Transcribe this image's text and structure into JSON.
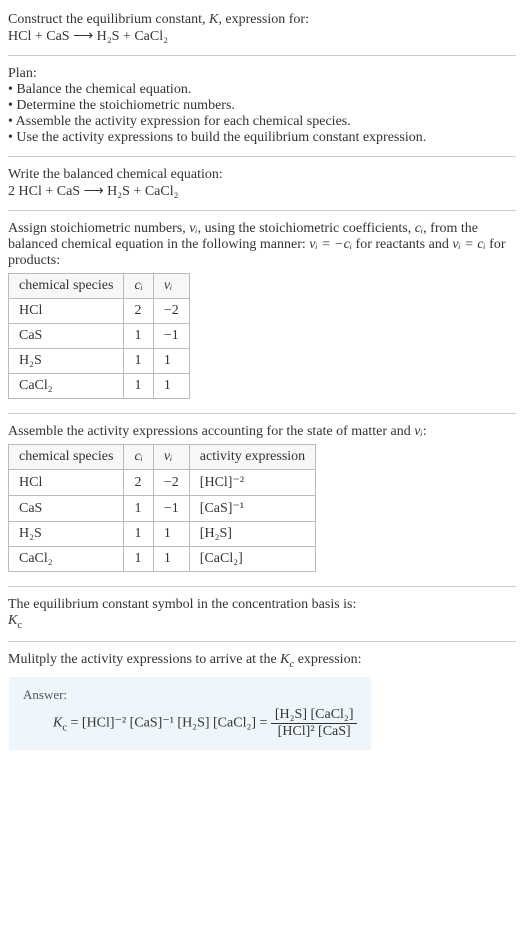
{
  "intro": {
    "line1_a": "Construct the equilibrium constant, ",
    "line1_b": ", expression for:",
    "eq_unbalanced": "HCl + CaS  ⟶  H₂S + CaCl₂"
  },
  "plan": {
    "heading": "Plan:",
    "b1": "• Balance the chemical equation.",
    "b2": "• Determine the stoichiometric numbers.",
    "b3": "• Assemble the activity expression for each chemical species.",
    "b4": "• Use the activity expressions to build the equilibrium constant expression."
  },
  "balanced": {
    "heading": "Write the balanced chemical equation:",
    "eq": "2 HCl + CaS  ⟶  H₂S + CaCl₂"
  },
  "stoich": {
    "text_a": "Assign stoichiometric numbers, ",
    "text_b": ", using the stoichiometric coefficients, ",
    "text_c": ", from the balanced chemical equation in the following manner: ",
    "text_d": " for reactants and ",
    "text_e": " for products:",
    "nu_sym": "νᵢ",
    "c_sym": "cᵢ",
    "rel_react": "νᵢ = −cᵢ",
    "rel_prod": "νᵢ = cᵢ",
    "headers": {
      "h1": "chemical species",
      "h2": "cᵢ",
      "h3": "νᵢ"
    },
    "rows": [
      {
        "sp": "HCl",
        "c": "2",
        "nu": "−2"
      },
      {
        "sp": "CaS",
        "c": "1",
        "nu": "−1"
      },
      {
        "sp": "H₂S",
        "c": "1",
        "nu": "1"
      },
      {
        "sp": "CaCl₂",
        "c": "1",
        "nu": "1"
      }
    ]
  },
  "activity": {
    "heading_a": "Assemble the activity expressions accounting for the state of matter and ",
    "heading_b": ":",
    "headers": {
      "h1": "chemical species",
      "h2": "cᵢ",
      "h3": "νᵢ",
      "h4": "activity expression"
    },
    "rows": [
      {
        "sp": "HCl",
        "c": "2",
        "nu": "−2",
        "act": "[HCl]⁻²"
      },
      {
        "sp": "CaS",
        "c": "1",
        "nu": "−1",
        "act": "[CaS]⁻¹"
      },
      {
        "sp": "H₂S",
        "c": "1",
        "nu": "1",
        "act": "[H₂S]"
      },
      {
        "sp": "CaCl₂",
        "c": "1",
        "nu": "1",
        "act": "[CaCl₂]"
      }
    ]
  },
  "basis": {
    "line": "The equilibrium constant symbol in the concentration basis is:",
    "sym": "K",
    "sub": "c"
  },
  "mult": {
    "line_a": "Mulitply the activity expressions to arrive at the ",
    "line_b": " expression:"
  },
  "answer": {
    "label": "Answer:",
    "lhs_K": "K",
    "lhs_sub": "c",
    "mid": " = [HCl]⁻² [CaS]⁻¹ [H₂S] [CaCl₂] = ",
    "num": "[H₂S] [CaCl₂]",
    "den": "[HCl]² [CaS]"
  },
  "chart_data": {
    "type": "table",
    "tables": [
      {
        "title": "stoichiometric numbers",
        "columns": [
          "chemical species",
          "cᵢ",
          "νᵢ"
        ],
        "rows": [
          [
            "HCl",
            2,
            -2
          ],
          [
            "CaS",
            1,
            -1
          ],
          [
            "H₂S",
            1,
            1
          ],
          [
            "CaCl₂",
            1,
            1
          ]
        ]
      },
      {
        "title": "activity expressions",
        "columns": [
          "chemical species",
          "cᵢ",
          "νᵢ",
          "activity expression"
        ],
        "rows": [
          [
            "HCl",
            2,
            -2,
            "[HCl]^-2"
          ],
          [
            "CaS",
            1,
            -1,
            "[CaS]^-1"
          ],
          [
            "H₂S",
            1,
            1,
            "[H₂S]"
          ],
          [
            "CaCl₂",
            1,
            1,
            "[CaCl₂]"
          ]
        ]
      }
    ]
  }
}
